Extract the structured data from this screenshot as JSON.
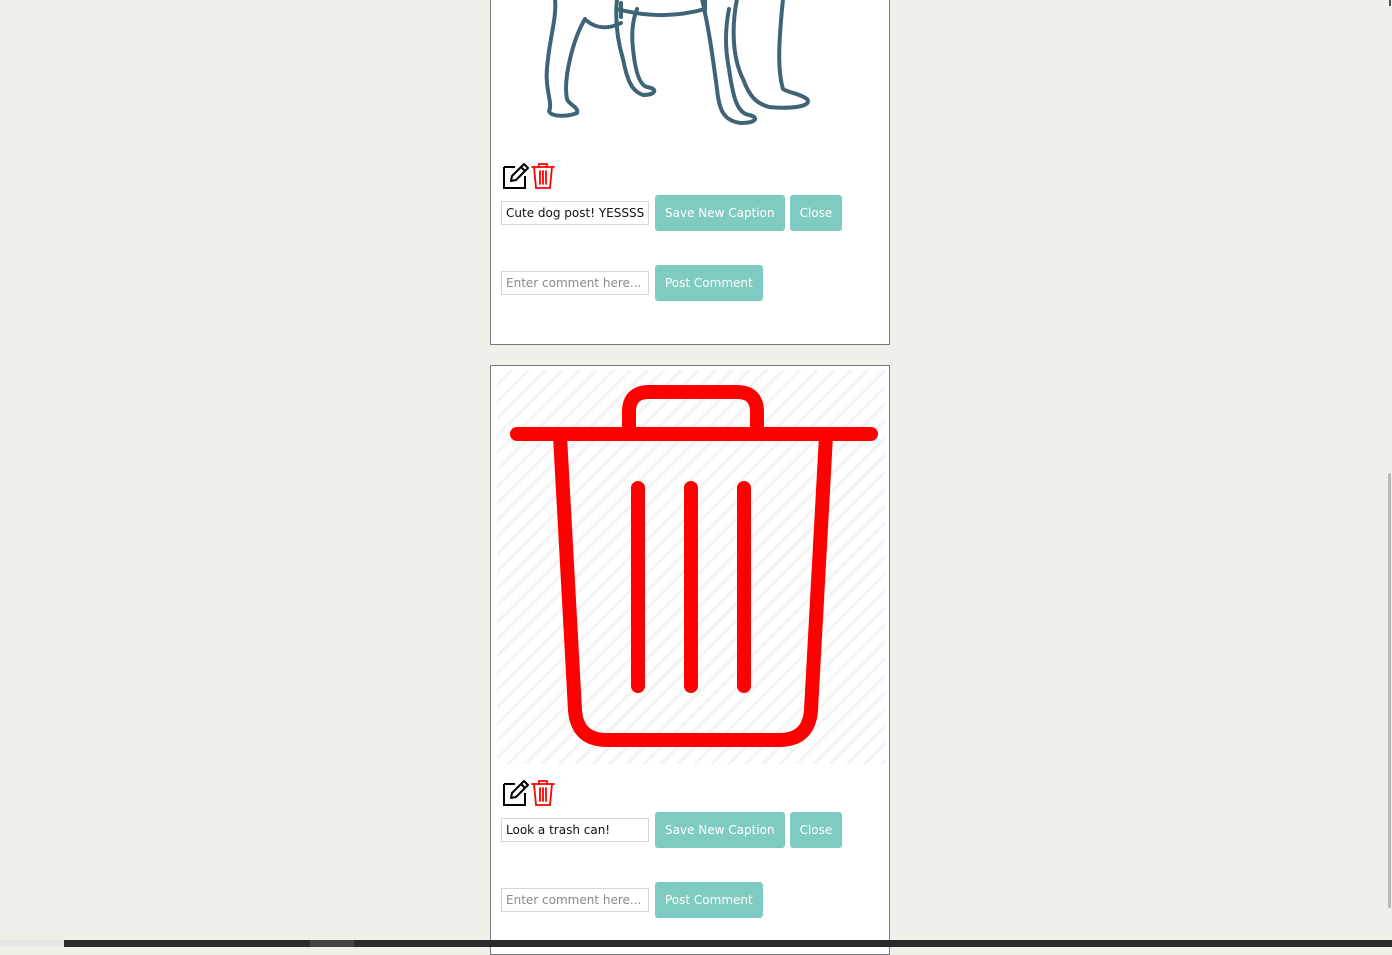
{
  "posts": [
    {
      "image_alt": "dog illustration",
      "caption_value": "Cute dog post! YESSSS",
      "save_label": "Save New Caption",
      "close_label": "Close",
      "comment_placeholder": "Enter comment here...",
      "post_comment_label": "Post Comment"
    },
    {
      "image_alt": "trash can",
      "caption_value": "Look a trash can!",
      "save_label": "Save New Caption",
      "close_label": "Close",
      "comment_placeholder": "Enter comment here...",
      "post_comment_label": "Post Comment"
    }
  ],
  "icons": {
    "edit": "edit-icon",
    "delete": "trash-icon"
  },
  "colors": {
    "button_bg": "#7fcbc2",
    "trash_red": "#ff0000",
    "dog_stroke": "#3e6478",
    "page_bg": "#f1efea"
  }
}
